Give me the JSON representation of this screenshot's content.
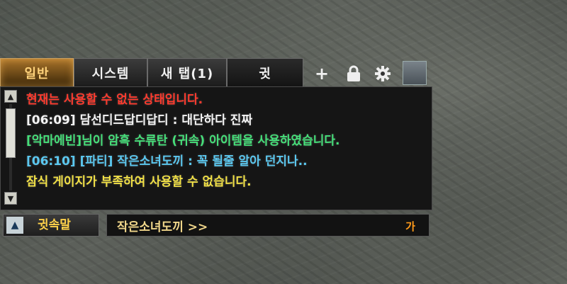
{
  "tabs": [
    {
      "label": "일반"
    },
    {
      "label": "시스템"
    },
    {
      "label": "새 탭(1)"
    },
    {
      "label": "귓"
    }
  ],
  "toolbar": {
    "add_icon": "plus-icon",
    "lock_icon": "lock-icon",
    "settings_icon": "gear-icon",
    "resize_icon": "resize-handle"
  },
  "messages": [
    {
      "text": "현재는 사용할 수 없는 상태입니다.",
      "color": "#ff3b2e"
    },
    {
      "text": "[06:09] 담선디드답디답디 : 대단하다 진짜",
      "color": "#f4f4f4"
    },
    {
      "text": "[악마에빈]님이 암흑 수류탄 (귀속) 아이템을 사용하였습니다.",
      "color": "#46e07a"
    },
    {
      "text": "[06:10] [파티] 작은소녀도끼 : 꼭 될줄 알아 던지나..",
      "color": "#5bc8f0"
    },
    {
      "text": "잠식 게이지가 부족하여 사용할 수 없습니다.",
      "color": "#f1e046"
    }
  ],
  "input_bar": {
    "mode_label": "귓속말",
    "target": "작은소녀도끼 >>",
    "send_label": "가"
  }
}
